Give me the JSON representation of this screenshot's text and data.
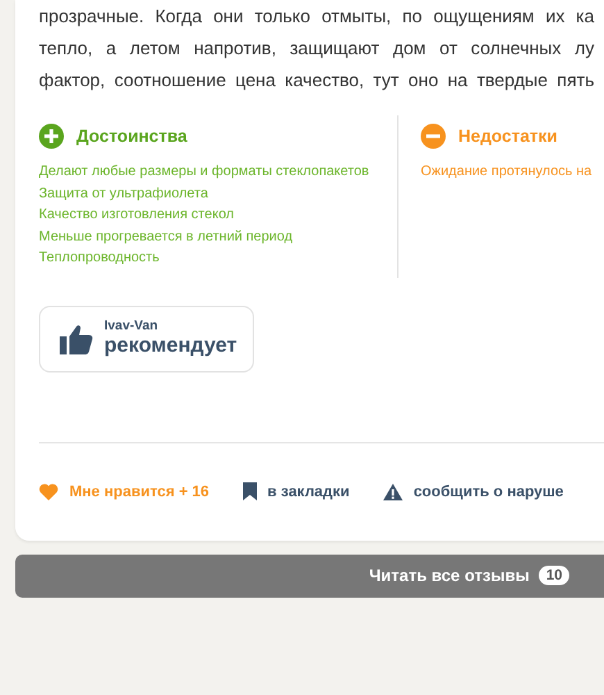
{
  "review": {
    "text_lines": [
      "прозрачные. Когда они только отмыты, по ощущениям их ка",
      "тепло, а летом напротив, защищают дом от солнечных лу",
      "фактор, соотношение цена качество, тут оно на твердые пять"
    ],
    "pros": {
      "title": "Достоинства",
      "items": [
        "Делают любые размеры и форматы стеклопакетов",
        "Защита от ультрафиолета",
        "Качество изготовления стекол",
        "Меньше прогревается в летний период",
        "Теплопроводность"
      ]
    },
    "cons": {
      "title": "Недостатки",
      "items": [
        "Ожидание протянулось на"
      ]
    },
    "recommend": {
      "author": "Ivav-Van",
      "verdict": "рекомендует"
    },
    "actions": [
      {
        "kind": "like",
        "label": "Мне нравится + 16"
      },
      {
        "kind": "bookmark",
        "label": "в закладки"
      },
      {
        "kind": "report",
        "label": "сообщить о наруше"
      }
    ]
  },
  "read_all": {
    "label": "Читать все отзывы",
    "count": "10"
  }
}
